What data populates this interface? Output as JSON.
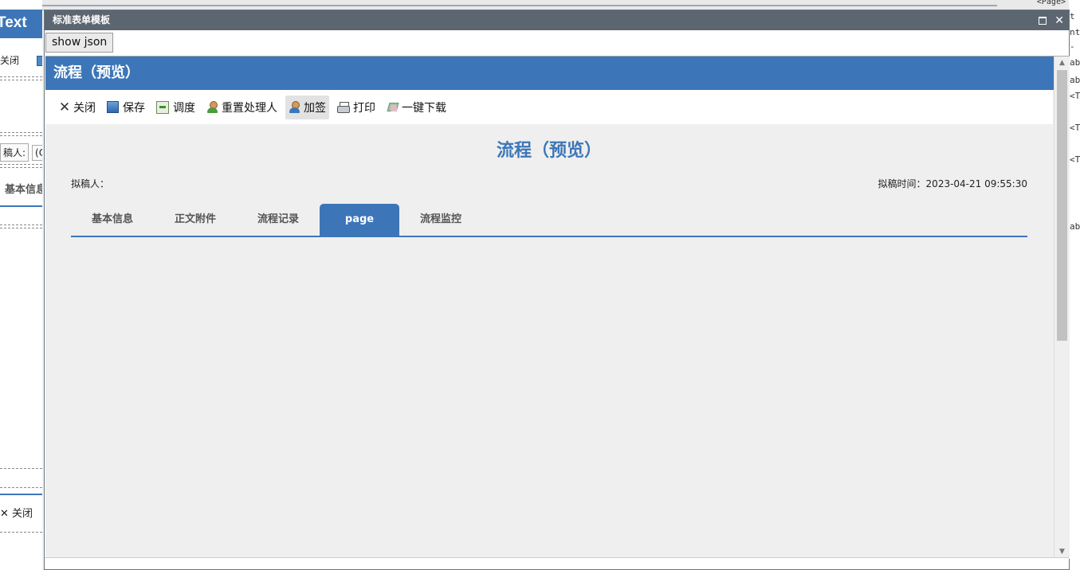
{
  "background": {
    "left_header": "Text",
    "left_toolbar_close": "关闭",
    "left_row_label": "稿人:",
    "left_row_value": "(C",
    "left_tab": "基本信息",
    "left_close": "关闭",
    "top_tag": "<Page>",
    "right_chars": [
      "t",
      "nt",
      "-",
      "ab",
      "ab",
      "<T",
      "<T",
      "<T",
      "ab"
    ]
  },
  "window": {
    "title": "标准表单模板"
  },
  "show_json_label": "show json",
  "page": {
    "header_title": "流程（预览）",
    "toolbar": [
      {
        "label": "关闭",
        "icon": "close-icon"
      },
      {
        "label": "保存",
        "icon": "save-icon"
      },
      {
        "label": "调度",
        "icon": "dispatch-icon"
      },
      {
        "label": "重置处理人",
        "icon": "user-icon"
      },
      {
        "label": "加签",
        "icon": "add-signer-icon"
      },
      {
        "label": "打印",
        "icon": "printer-icon"
      },
      {
        "label": "一键下载",
        "icon": "download-icon"
      }
    ],
    "active_toolbar_index": 4,
    "form_title": "流程（预览）",
    "drafter_label": "拟稿人：",
    "draft_time_label": "拟稿时间：",
    "draft_time_value": "2023-04-21 09:55:30",
    "tabs": [
      "基本信息",
      "正文附件",
      "流程记录",
      "page",
      "流程监控"
    ],
    "active_tab": "page"
  },
  "colors": {
    "accent": "#3c76b8",
    "title_bar": "#5c6670",
    "page_bg": "#efefef"
  }
}
